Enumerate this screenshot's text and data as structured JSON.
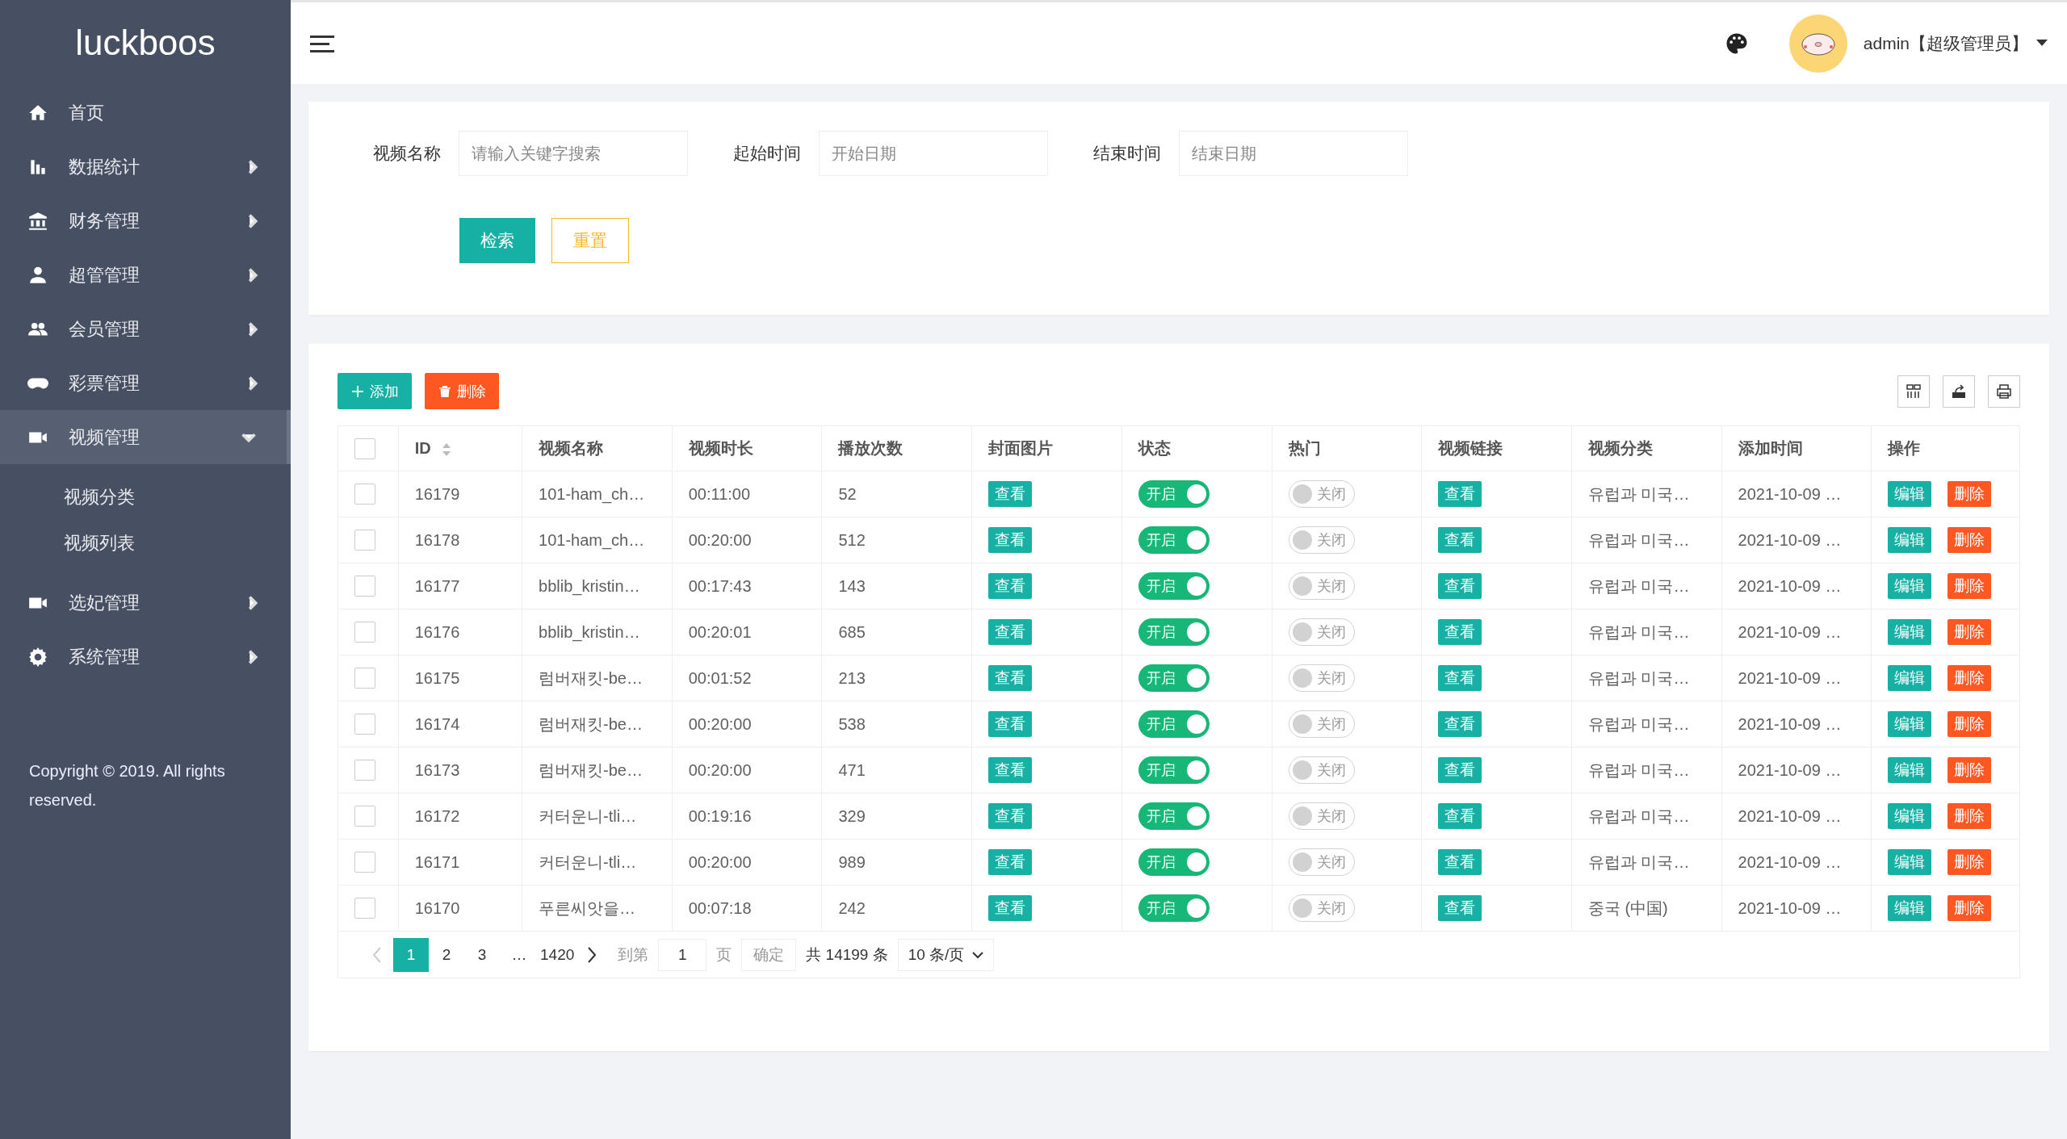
{
  "sidebar": {
    "logo": "luckboos",
    "items": [
      {
        "label": "首页"
      },
      {
        "label": "数据统计",
        "expanded": false
      },
      {
        "label": "财务管理",
        "expanded": false
      },
      {
        "label": "超管管理",
        "expanded": false
      },
      {
        "label": "会员管理",
        "expanded": false
      },
      {
        "label": "彩票管理",
        "expanded": false
      },
      {
        "label": "视频管理",
        "expanded": true,
        "children": [
          {
            "label": "视频分类"
          },
          {
            "label": "视频列表"
          }
        ]
      },
      {
        "label": "选妃管理",
        "expanded": false
      },
      {
        "label": "系统管理",
        "expanded": false
      }
    ],
    "copyright": "Copyright © 2019. All rights reserved."
  },
  "header": {
    "user": "admin【超级管理员】"
  },
  "search": {
    "fields": [
      {
        "label": "视频名称",
        "placeholder": "请输入关键字搜索"
      },
      {
        "label": "起始时间",
        "placeholder": "开始日期"
      },
      {
        "label": "结束时间",
        "placeholder": "结束日期"
      }
    ],
    "buttons": [
      {
        "label": "检索",
        "kind": "primary"
      },
      {
        "label": "重置",
        "kind": "outline"
      }
    ]
  },
  "toolbar": {
    "buttons": [
      {
        "label": "添加",
        "kind": "add"
      },
      {
        "label": "删除",
        "kind": "delete"
      }
    ]
  },
  "table": {
    "header_checked": false,
    "columns": [
      "ID",
      "视频名称",
      "视频时长",
      "播放次数",
      "封面图片",
      "状态",
      "热门",
      "视频链接",
      "视频分类",
      "添加时间",
      "操作"
    ],
    "rows": [
      {
        "checked": false,
        "id": "16179",
        "name": "101-ham_ch…",
        "duration": "00:11:00",
        "plays": "52",
        "cover": "查看",
        "status": {
          "label": "开启",
          "on": true
        },
        "hot": {
          "label": "关闭",
          "on": false
        },
        "link": "查看",
        "category": "유럽과 미국…",
        "time": "2021-10-09 …",
        "edit": "编辑",
        "delete": "删除"
      },
      {
        "checked": false,
        "id": "16178",
        "name": "101-ham_ch…",
        "duration": "00:20:00",
        "plays": "512",
        "cover": "查看",
        "status": {
          "label": "开启",
          "on": true
        },
        "hot": {
          "label": "关闭",
          "on": false
        },
        "link": "查看",
        "category": "유럽과 미국…",
        "time": "2021-10-09 …",
        "edit": "编辑",
        "delete": "删除"
      },
      {
        "checked": false,
        "id": "16177",
        "name": "bblib_kristin…",
        "duration": "00:17:43",
        "plays": "143",
        "cover": "查看",
        "status": {
          "label": "开启",
          "on": true
        },
        "hot": {
          "label": "关闭",
          "on": false
        },
        "link": "查看",
        "category": "유럽과 미국…",
        "time": "2021-10-09 …",
        "edit": "编辑",
        "delete": "删除"
      },
      {
        "checked": false,
        "id": "16176",
        "name": "bblib_kristin…",
        "duration": "00:20:01",
        "plays": "685",
        "cover": "查看",
        "status": {
          "label": "开启",
          "on": true
        },
        "hot": {
          "label": "关闭",
          "on": false
        },
        "link": "查看",
        "category": "유럽과 미국…",
        "time": "2021-10-09 …",
        "edit": "编辑",
        "delete": "删除"
      },
      {
        "checked": false,
        "id": "16175",
        "name": "럼버재킷-be…",
        "duration": "00:01:52",
        "plays": "213",
        "cover": "查看",
        "status": {
          "label": "开启",
          "on": true
        },
        "hot": {
          "label": "关闭",
          "on": false
        },
        "link": "查看",
        "category": "유럽과 미국…",
        "time": "2021-10-09 …",
        "edit": "编辑",
        "delete": "删除"
      },
      {
        "checked": false,
        "id": "16174",
        "name": "럼버재킷-be…",
        "duration": "00:20:00",
        "plays": "538",
        "cover": "查看",
        "status": {
          "label": "开启",
          "on": true
        },
        "hot": {
          "label": "关闭",
          "on": false
        },
        "link": "查看",
        "category": "유럽과 미국…",
        "time": "2021-10-09 …",
        "edit": "编辑",
        "delete": "删除"
      },
      {
        "checked": false,
        "id": "16173",
        "name": "럼버재킷-be…",
        "duration": "00:20:00",
        "plays": "471",
        "cover": "查看",
        "status": {
          "label": "开启",
          "on": true
        },
        "hot": {
          "label": "关闭",
          "on": false
        },
        "link": "查看",
        "category": "유럽과 미국…",
        "time": "2021-10-09 …",
        "edit": "编辑",
        "delete": "删除"
      },
      {
        "checked": false,
        "id": "16172",
        "name": "커터운니-tli…",
        "duration": "00:19:16",
        "plays": "329",
        "cover": "查看",
        "status": {
          "label": "开启",
          "on": true
        },
        "hot": {
          "label": "关闭",
          "on": false
        },
        "link": "查看",
        "category": "유럽과 미국…",
        "time": "2021-10-09 …",
        "edit": "编辑",
        "delete": "删除"
      },
      {
        "checked": false,
        "id": "16171",
        "name": "커터운니-tli…",
        "duration": "00:20:00",
        "plays": "989",
        "cover": "查看",
        "status": {
          "label": "开启",
          "on": true
        },
        "hot": {
          "label": "关闭",
          "on": false
        },
        "link": "查看",
        "category": "유럽과 미국…",
        "time": "2021-10-09 …",
        "edit": "编辑",
        "delete": "删除"
      },
      {
        "checked": false,
        "id": "16170",
        "name": "푸른씨앗을…",
        "duration": "00:07:18",
        "plays": "242",
        "cover": "查看",
        "status": {
          "label": "开启",
          "on": true
        },
        "hot": {
          "label": "关闭",
          "on": false
        },
        "link": "查看",
        "category": "중국 (中国)",
        "time": "2021-10-09 …",
        "edit": "编辑",
        "delete": "删除"
      }
    ]
  },
  "pagination": {
    "prev_disabled": true,
    "pages": [
      {
        "label": "1",
        "selected": true
      },
      {
        "label": "2",
        "selected": false
      },
      {
        "label": "3",
        "selected": false
      }
    ],
    "ellipsis": "…",
    "last": "1420",
    "goto_label": "到第",
    "goto_value": "1",
    "page_unit": "页",
    "confirm": "确定",
    "total": "共 14199 条",
    "page_size": "10 条/页"
  }
}
